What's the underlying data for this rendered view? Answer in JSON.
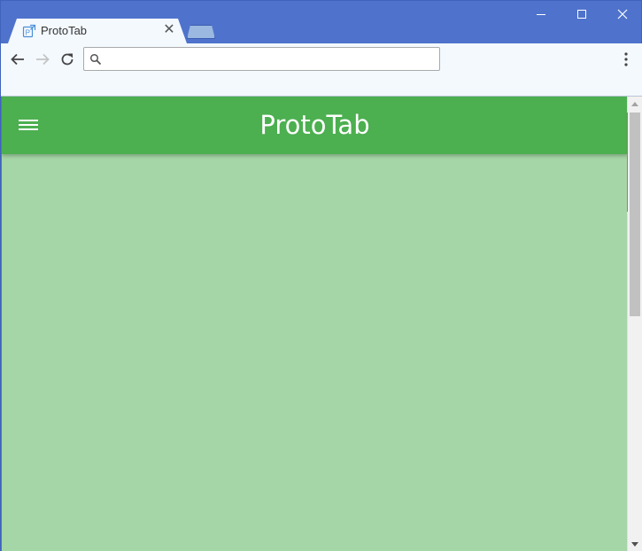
{
  "browser": {
    "tab": {
      "title": "ProtoTab",
      "favicon": "prototab-favicon-icon",
      "close_glyph": "✕"
    },
    "window_controls": [
      "minimize-icon",
      "maximize-icon",
      "close-icon"
    ],
    "toolbar": {
      "back_icon": "arrow-left-icon",
      "forward_icon": "arrow-right-icon",
      "reload_icon": "reload-icon",
      "address": {
        "value": "",
        "placeholder": ""
      },
      "menu_icon": "kebab-menu-icon"
    }
  },
  "page": {
    "app_bar": {
      "title": "ProtoTab",
      "menu_icon": "hamburger-menu-icon"
    },
    "colors": {
      "app_bar": "#4caf50",
      "background": "#a5d6a7",
      "title_text": "#ffffff"
    }
  },
  "colors": {
    "window_frame": "#4f73cc",
    "toolbar": "#f4f9fe"
  }
}
